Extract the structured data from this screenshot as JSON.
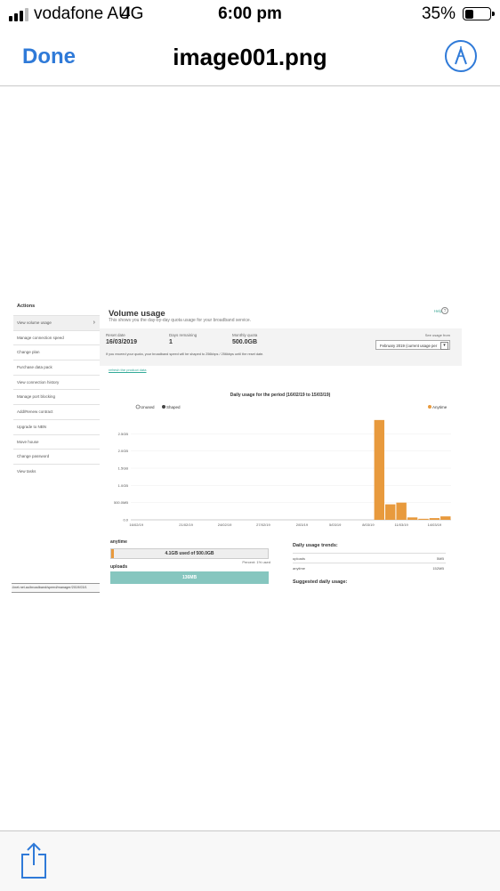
{
  "status_bar": {
    "carrier": "vodafone AU",
    "network": "4G",
    "time": "6:00 pm",
    "battery_percent": "35%",
    "battery_level": 0.35,
    "signal_bars": 3,
    "signal_bars_max": 4,
    "icons": [
      "signal-icon",
      "battery-icon"
    ]
  },
  "nav": {
    "done_label": "Done",
    "title": "image001.png",
    "markup_icon": "markup-pen-icon",
    "accent_color": "#2f7ad8"
  },
  "toolbar": {
    "share_icon": "share-icon"
  },
  "screenshot": {
    "sidebar": {
      "heading": "Actions",
      "items": [
        "View volume usage",
        "Manage connection speed",
        "Change plan",
        "Purchase data pack",
        "View connection history",
        "Manage port blocking",
        "Add/Renew contract",
        "Upgrade to NBN",
        "Move house",
        "Change password",
        "View tasks"
      ]
    },
    "url_fragment": "iiii.iinet.net.au/broadband/speed/manager/2019/03/1",
    "volume": {
      "title": "Volume usage",
      "subtitle": "This shows you the day-by-day quota usage for your broadband service.",
      "help_label": "Help",
      "reset_label": "Reset date",
      "reset_value": "16/03/2019",
      "days_label": "Days remaining",
      "days_value": "1",
      "quota_label": "Monthly quota",
      "quota_value": "500.0GB",
      "see_usage_label": "See usage from",
      "period_select": "February 2019 (current usage per",
      "quota_note": "If you exceed your quota, your broadband speed will be shaped to 256kbps / 256kbps until the reset date.",
      "refresh_link": "refresh the product data"
    },
    "anytime_label": "anytime",
    "anytime_usage": "4.1GB used of 500.0GB",
    "anytime_pct": "Percent: 1% used",
    "anytime_fraction": 0.0082,
    "uploads_label": "uploads",
    "uploads_value": "136MB",
    "trends_title": "Daily usage trends:",
    "trends": [
      {
        "label": "uploads",
        "value": "5MB"
      },
      {
        "label": "anytime",
        "value": "152MB"
      }
    ],
    "suggested_title": "Suggested daily usage:"
  },
  "chart_data": {
    "type": "bar",
    "title": "Daily usage for the period (16/02/19 to 15/03/19)",
    "legend": [
      "Unused",
      "Shaped",
      "Anytime"
    ],
    "legend_placement": "top",
    "series": [
      {
        "name": "Anytime",
        "color": "#e89a3d",
        "values": [
          0,
          0,
          0,
          0,
          0,
          0,
          0,
          0,
          0,
          0,
          0,
          0,
          0,
          0,
          0,
          0,
          0,
          0,
          0,
          0,
          0,
          0,
          2.9,
          0.45,
          0.5,
          0.07,
          0.03,
          0.05,
          0.1
        ]
      }
    ],
    "x_count": 29,
    "xtick_labels": [
      {
        "label": "16/02/19",
        "index": 0.5
      },
      {
        "label": "21/02/19",
        "index": 5
      },
      {
        "label": "24/02/19",
        "index": 8.5
      },
      {
        "label": "27/02/19",
        "index": 12
      },
      {
        "label": "2/03/19",
        "index": 15.5
      },
      {
        "label": "5/03/19",
        "index": 18.5
      },
      {
        "label": "8/03/19",
        "index": 21.5
      },
      {
        "label": "11/03/19",
        "index": 24.5
      },
      {
        "label": "14/03/19",
        "index": 27.5
      }
    ],
    "ytick_labels": [
      {
        "label": "0.0",
        "value": 0
      },
      {
        "label": "500.0MB",
        "value": 0.5
      },
      {
        "label": "1.0GB",
        "value": 1.0
      },
      {
        "label": "1.5GB",
        "value": 1.5
      },
      {
        "label": "2.0GB",
        "value": 2.0
      },
      {
        "label": "2.5GB",
        "value": 2.5
      }
    ],
    "ylim": [
      0,
      3.0
    ],
    "grid": true
  }
}
